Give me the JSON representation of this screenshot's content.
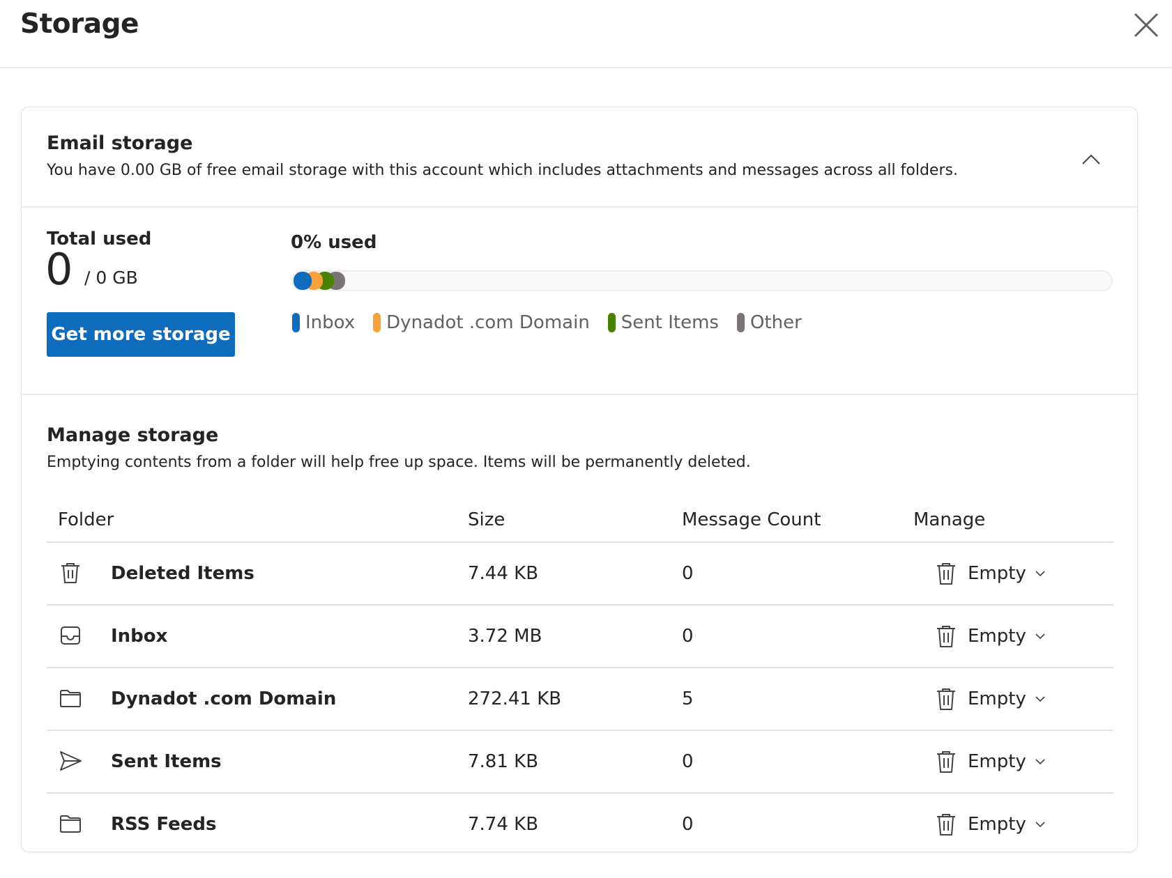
{
  "header": {
    "title": "Storage",
    "close_icon": "close-icon"
  },
  "email_storage": {
    "title": "Email storage",
    "description": "You have 0.00 GB of free email storage with this account which includes attachments and messages across all folders.",
    "collapse_icon": "chevron-up-icon"
  },
  "usage": {
    "total_label": "Total used",
    "total_value": "0",
    "total_unit": "/ 0 GB",
    "get_more_label": "Get more storage",
    "percent_label": "0% used",
    "percent_used": 0,
    "legend": [
      {
        "label": "Inbox",
        "color": "#0f6cbd"
      },
      {
        "label": "Dynadot .com Domain",
        "color": "#f7a13a"
      },
      {
        "label": "Sent Items",
        "color": "#498205"
      },
      {
        "label": "Other",
        "color": "#7a7574"
      }
    ]
  },
  "manage_storage": {
    "title": "Manage storage",
    "description": "Emptying contents from a folder will help free up space. Items will be permanently deleted.",
    "columns": {
      "folder": "Folder",
      "size": "Size",
      "count": "Message Count",
      "manage": "Manage"
    },
    "rows": [
      {
        "icon": "delete-icon",
        "name": "Deleted Items",
        "size": "7.44 KB",
        "count": "0",
        "action": "Empty"
      },
      {
        "icon": "inbox-icon",
        "name": "Inbox",
        "size": "3.72 MB",
        "count": "0",
        "action": "Empty"
      },
      {
        "icon": "folder-icon",
        "name": "Dynadot .com Domain",
        "size": "272.41 KB",
        "count": "5",
        "action": "Empty"
      },
      {
        "icon": "send-icon",
        "name": "Sent Items",
        "size": "7.81 KB",
        "count": "0",
        "action": "Empty"
      },
      {
        "icon": "folder-icon",
        "name": "RSS Feeds",
        "size": "7.74 KB",
        "count": "0",
        "action": "Empty"
      }
    ]
  }
}
